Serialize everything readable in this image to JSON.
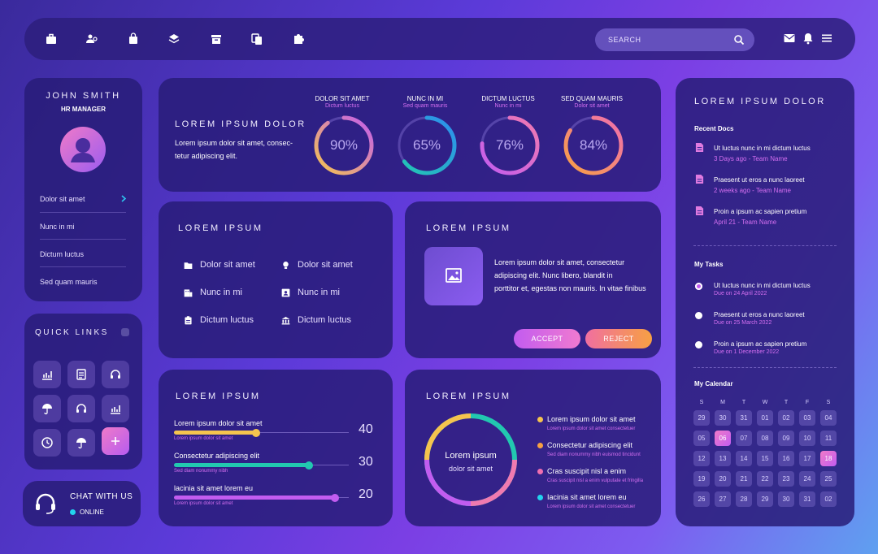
{
  "topbar": {
    "search_placeholder": "SEARCH",
    "icons": [
      "briefcase-icon",
      "users-icon",
      "bag-icon",
      "layers-icon",
      "archive-icon",
      "copy-icon",
      "puzzle-icon"
    ],
    "right_icons": [
      "mail-icon",
      "bell-icon",
      "menu-icon"
    ]
  },
  "profile": {
    "name": "JOHN SMITH",
    "role": "HR MANAGER",
    "menu": [
      "Dolor sit amet",
      "Nunc in mi",
      "Dictum luctus",
      "Sed quam mauris"
    ]
  },
  "quick_links": {
    "title": "QUICK LINKS",
    "icons": [
      "chart-icon",
      "document-icon",
      "headset-icon",
      "umbrella-icon",
      "headset-icon",
      "chart-icon",
      "clock-icon",
      "umbrella-icon",
      "plus-icon"
    ]
  },
  "chat": {
    "label": "CHAT WITH US",
    "status": "ONLINE",
    "status_color": "#22d3ee"
  },
  "stats": {
    "title": "LOREM IPSUM DOLOR",
    "text": [
      "Lorem ipsum dolor sit amet, consec-",
      "tetur adipiscing elit."
    ],
    "rings": [
      {
        "label": "DOLOR SIT AMET",
        "sub": "Dictum luctus",
        "value": "90%",
        "pct": 0.9
      },
      {
        "label": "NUNC IN MI",
        "sub": "Sed quam mauris",
        "value": "65%",
        "pct": 0.65
      },
      {
        "label": "DICTUM LUCTUS",
        "sub": "Nunc in mi",
        "value": "76%",
        "pct": 0.76
      },
      {
        "label": "SED QUAM MAURIS",
        "sub": "Dolor sit amet",
        "value": "84%",
        "pct": 0.84
      }
    ]
  },
  "menu_panel": {
    "title": "LOREM IPSUM",
    "items": [
      {
        "icon": "folder-icon",
        "label": "Dolor sit amet"
      },
      {
        "icon": "lightbulb-icon",
        "label": "Dolor sit amet"
      },
      {
        "icon": "building-icon",
        "label": "Nunc in mi"
      },
      {
        "icon": "contact-icon",
        "label": "Nunc in mi"
      },
      {
        "icon": "clipboard-icon",
        "label": "Dictum luctus"
      },
      {
        "icon": "bank-icon",
        "label": "Dictum luctus"
      }
    ]
  },
  "media_panel": {
    "title": "LOREM IPSUM",
    "text": [
      "Lorem ipsum dolor sit amet, consectetur",
      "adipiscing elit. Nunc libero, blandit in",
      "porttitor et, egestas non mauris. In vitae finibus"
    ],
    "accept": "ACCEPT",
    "reject": "REJECT"
  },
  "sliders": {
    "title": "LOREM IPSUM",
    "items": [
      {
        "label": "Lorem ipsum dolor sit amet",
        "sub": "Lorem ipsum dolor sit amet",
        "value": "40",
        "level": 0.47,
        "color": "#f5c44e"
      },
      {
        "label": "Consectetur adipiscing elit",
        "sub": "Sed diam nonummy nibh",
        "value": "30",
        "level": 0.77,
        "color": "#22c8b0"
      },
      {
        "label": "lacinia sit amet lorem eu",
        "sub": "Lorem ipsum dolor sit amet",
        "value": "20",
        "level": 0.92,
        "color": "#c25cf0"
      }
    ]
  },
  "donut": {
    "title": "LOREM IPSUM",
    "center1": "Lorem ipsum",
    "center2": "dolor sit amet",
    "legend": [
      {
        "label": "Lorem ipsum dolor sit amet",
        "sub": "Lorem ipsum dolor sit amet consectetuer",
        "color": "#f5c44e"
      },
      {
        "label": "Consectetur adipiscing elit",
        "sub": "Sed diam nonummy nibh euismod tincidunt",
        "color": "#f7a043"
      },
      {
        "label": "Cras suscipit nisl a enim",
        "sub": "Cras suscipit nisl a enim vulputate et fringilla",
        "color": "#f06fb0"
      },
      {
        "label": "Iacinia sit amet lorem eu",
        "sub": "Lorem ipsum dolor sit amet consectetuer",
        "color": "#22d3ee"
      }
    ]
  },
  "right": {
    "title": "LOREM IPSUM DOLOR",
    "recent_title": "Recent Docs",
    "docs": [
      {
        "label": "Ut luctus nunc in mi dictum luctus",
        "sub": "3 Days ago - Team Name"
      },
      {
        "label": "Praesent ut eros a nunc laoreet",
        "sub": "2 weeks ago - Team Name"
      },
      {
        "label": "Proin a ipsum ac sapien pretium",
        "sub": "April 21 - Team Name"
      }
    ],
    "tasks_title": "My Tasks",
    "tasks": [
      {
        "label": "Ut luctus nunc in mi dictum luctus",
        "sub": "Due on 24 April 2022"
      },
      {
        "label": "Praesent ut eros a nunc laoreet",
        "sub": "Due on 25 March 2022"
      },
      {
        "label": "Proin a ipsum ac sapien pretium",
        "sub": "Due on 1 December 2022"
      }
    ],
    "calendar_title": "My Calendar",
    "days": [
      "S",
      "M",
      "T",
      "W",
      "T",
      "F",
      "S"
    ],
    "dates": [
      "29",
      "30",
      "31",
      "01",
      "02",
      "03",
      "04",
      "05",
      "06",
      "07",
      "08",
      "09",
      "10",
      "11",
      "12",
      "13",
      "14",
      "15",
      "16",
      "17",
      "18",
      "19",
      "20",
      "21",
      "22",
      "23",
      "24",
      "25",
      "26",
      "27",
      "28",
      "29",
      "30",
      "31",
      "02"
    ],
    "highlighted": [
      "06",
      "18"
    ]
  }
}
